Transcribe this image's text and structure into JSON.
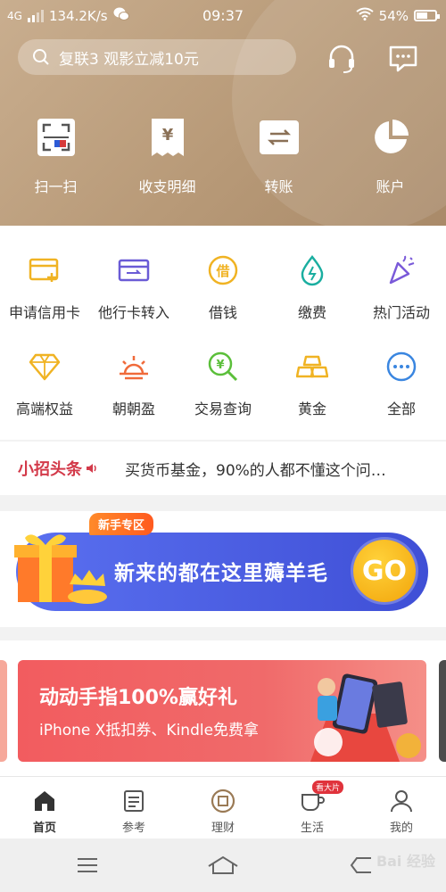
{
  "status_bar": {
    "network": "4G",
    "speed": "134.2K/s",
    "time": "09:37",
    "battery": "54%"
  },
  "search": {
    "placeholder": "复联3 观影立减10元"
  },
  "header_icons": [
    "headset-icon",
    "message-icon"
  ],
  "quick_actions": [
    {
      "label": "扫一扫",
      "icon": "scan-icon"
    },
    {
      "label": "收支明细",
      "icon": "receipt-icon"
    },
    {
      "label": "转账",
      "icon": "transfer-icon"
    },
    {
      "label": "账户",
      "icon": "pie-chart-icon"
    }
  ],
  "services": [
    {
      "label": "申请信用卡",
      "icon": "credit-card-apply-icon",
      "color": "#f0b323"
    },
    {
      "label": "他行卡转入",
      "icon": "card-transfer-in-icon",
      "color": "#6a5bd6"
    },
    {
      "label": "借钱",
      "icon": "borrow-icon",
      "color": "#f0b323"
    },
    {
      "label": "缴费",
      "icon": "water-drop-icon",
      "color": "#1aaea0"
    },
    {
      "label": "热门活动",
      "icon": "party-icon",
      "color": "#7a5ad9"
    },
    {
      "label": "高端权益",
      "icon": "diamond-icon",
      "color": "#f0b323"
    },
    {
      "label": "朝朝盈",
      "icon": "sunrise-icon",
      "color": "#f06a3a"
    },
    {
      "label": "交易查询",
      "icon": "search-yen-icon",
      "color": "#5bbf3a"
    },
    {
      "label": "黄金",
      "icon": "gold-bars-icon",
      "color": "#f0b323"
    },
    {
      "label": "全部",
      "icon": "more-icon",
      "color": "#3a86e0"
    }
  ],
  "news": {
    "tag": "小招头条",
    "text": "买货币基金，90%的人都不懂这个问…"
  },
  "banner1": {
    "tag": "新手专区",
    "title": "新来的都在这里薅羊毛",
    "go": "GO"
  },
  "banner2": {
    "title": "动动手指100%赢好礼",
    "subtitle": "iPhone X抵扣券、Kindle免费拿"
  },
  "tabs": [
    {
      "label": "首页",
      "icon": "home-icon",
      "active": true
    },
    {
      "label": "参考",
      "icon": "document-icon",
      "active": false
    },
    {
      "label": "理财",
      "icon": "wealth-icon",
      "active": false
    },
    {
      "label": "生活",
      "icon": "cup-icon",
      "active": false,
      "badge": "看大片"
    },
    {
      "label": "我的",
      "icon": "user-icon",
      "active": false
    }
  ],
  "watermark": "Bai 经验"
}
